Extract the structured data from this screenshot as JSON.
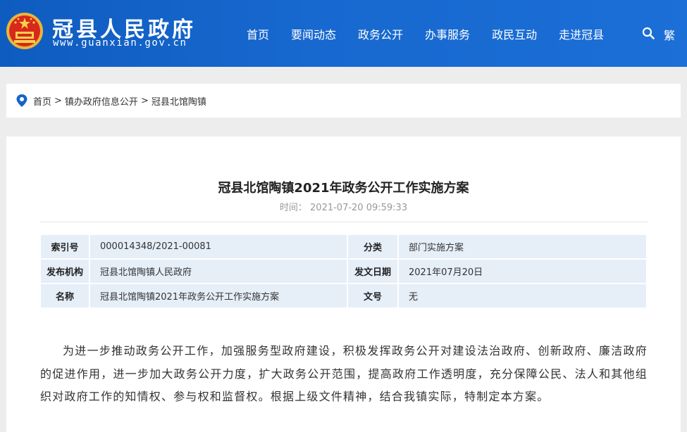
{
  "header": {
    "site_name": "冠县人民政府",
    "site_url": "www.guanxian.gov.cn",
    "nav": [
      "首页",
      "要闻动态",
      "政务公开",
      "办事服务",
      "政民互动",
      "走进冠县"
    ],
    "lang_toggle": "繁",
    "icons": {
      "emblem": "national-emblem-icon",
      "search": "search-icon"
    },
    "colors": {
      "header_bg": "#1565c9"
    }
  },
  "breadcrumb": {
    "items": [
      "首页",
      "镇办政府信息公开",
      "冠县北馆陶镇"
    ],
    "separator": ">",
    "icon": "location-pin-icon"
  },
  "article": {
    "title": "冠县北馆陶镇2021年政务公开工作实施方案",
    "time_label": "时间：",
    "time_value": "2021-07-20 09:59:33",
    "meta": {
      "index_label": "索引号",
      "index_value": "000014348/2021-00081",
      "category_label": "分类",
      "category_value": "部门实施方案",
      "publisher_label": "发布机构",
      "publisher_value": "冠县北馆陶镇人民政府",
      "date_label": "发文日期",
      "date_value": "2021年07月20日",
      "name_label": "名称",
      "name_value": "冠县北馆陶镇2021年政务公开工作实施方案",
      "doc_no_label": "文号",
      "doc_no_value": "无"
    },
    "body": "为进一步推动政务公开工作，加强服务型政府建设，积极发挥政务公开对建设法治政府、创新政府、廉洁政府的促进作用，进一步加大政务公开力度，扩大政务公开范围，提高政府工作透明度，充分保障公民、法人和其他组织对政府工作的知情权、参与权和监督权。根据上级文件精神，结合我镇实际，特制定本方案。"
  }
}
